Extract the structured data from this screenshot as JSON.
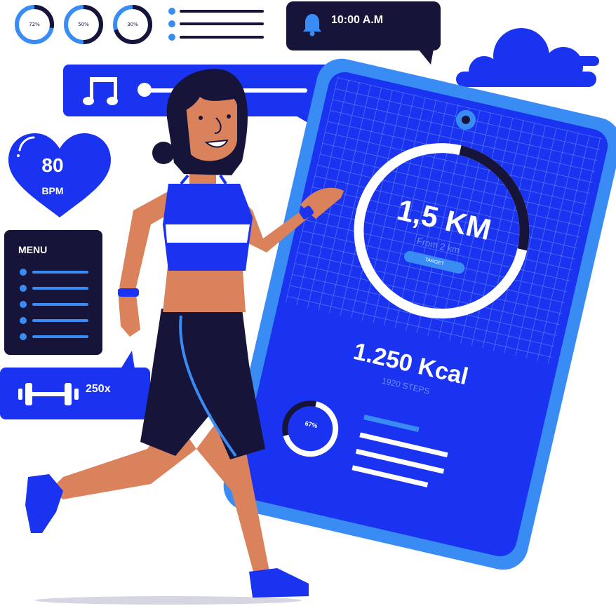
{
  "gauges": [
    {
      "label": "72%",
      "value": 0.72
    },
    {
      "label": "50%",
      "value": 0.5
    },
    {
      "label": "30%",
      "value": 0.3
    }
  ],
  "notification": {
    "time": "10:00 A.M",
    "icon": "bell-icon"
  },
  "music_player": {
    "icon": "music-note-icon",
    "progress": 0.05
  },
  "heart_rate": {
    "value": "80",
    "unit": "BPM",
    "icon": "heart-icon"
  },
  "menu": {
    "title": "MENU"
  },
  "workout": {
    "reps": "250x",
    "icon": "dumbbell-icon"
  },
  "phone": {
    "distance": "1,5 KM",
    "goal_text": "From 2 km",
    "target_label": "TARGET",
    "distance_progress": 0.75,
    "calories": "1.250 Kcal",
    "steps": "1920 STEPS",
    "small_gauge_label": "67%",
    "small_gauge_value": 0.67
  },
  "colors": {
    "primary_blue": "#1a33f0",
    "light_blue": "#3a8cf5",
    "dark_navy": "#17143a",
    "skin": "#d9825b"
  }
}
